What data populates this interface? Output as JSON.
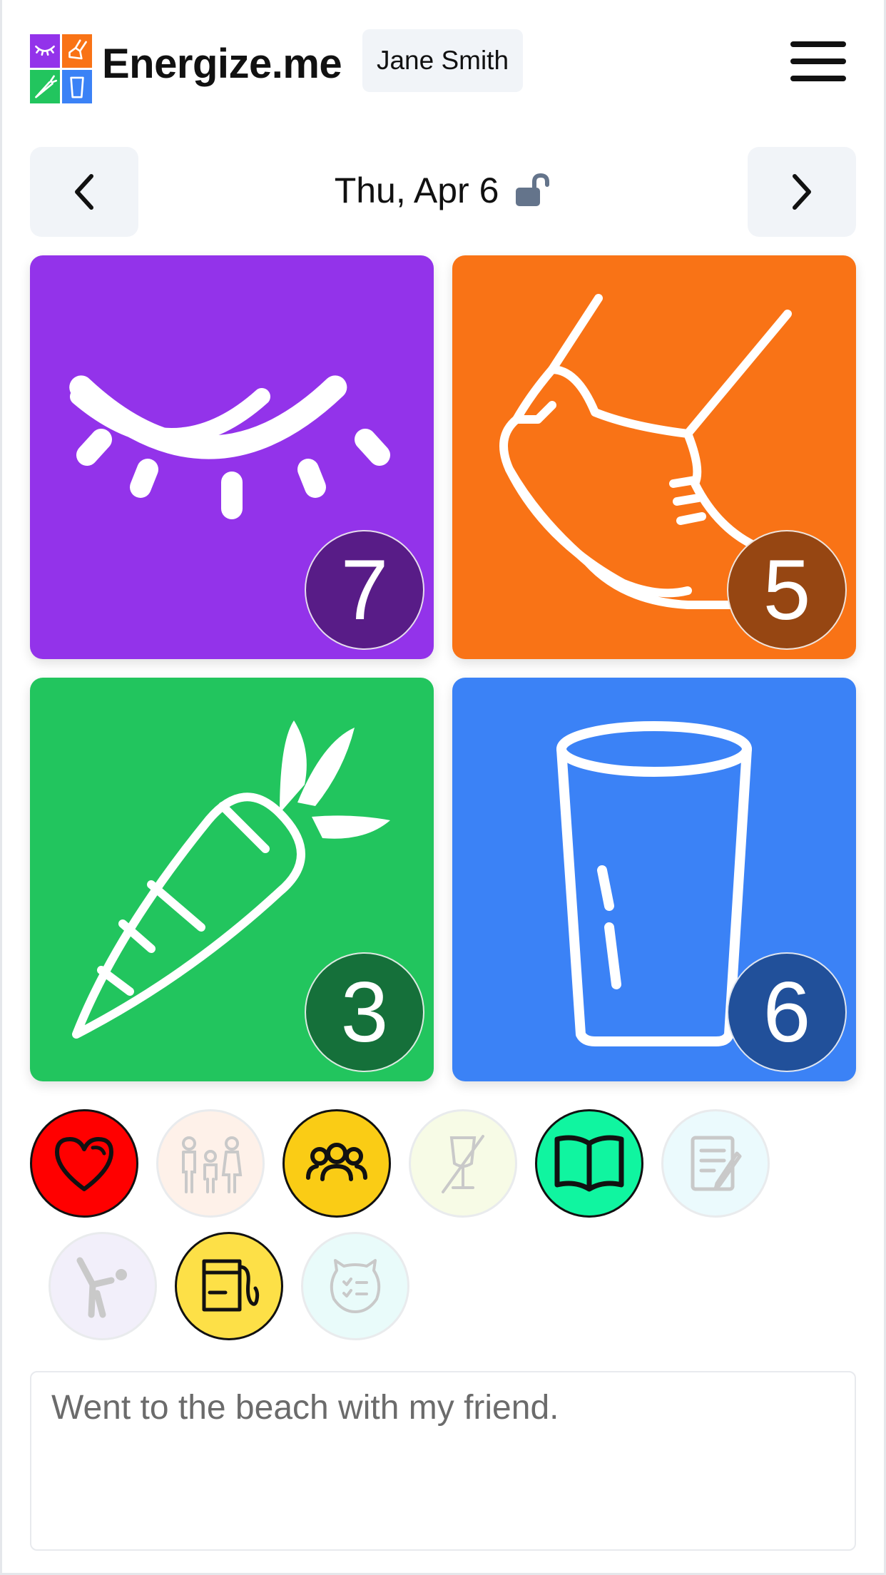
{
  "header": {
    "app_name": "Energize.me",
    "user_name": "Jane Smith",
    "logo_colors": [
      "#9333ea",
      "#f97316",
      "#22c55e",
      "#3b82f6"
    ]
  },
  "date_nav": {
    "date_label": "Thu, Apr 6",
    "lock_state": "unlocked"
  },
  "tiles": [
    {
      "name": "sleep",
      "icon": "closed-eye-icon",
      "color": "#9333ea",
      "badge_color": "#581c87",
      "score": "7"
    },
    {
      "name": "exercise",
      "icon": "sneaker-icon",
      "color": "#f97316",
      "badge_color": "#964612",
      "score": "5"
    },
    {
      "name": "food",
      "icon": "carrot-icon",
      "color": "#22c55e",
      "badge_color": "#15703a",
      "score": "3"
    },
    {
      "name": "water",
      "icon": "glass-icon",
      "color": "#3b82f6",
      "badge_color": "#21509a",
      "score": "6"
    }
  ],
  "activities": [
    {
      "name": "love",
      "icon": "heart-icon",
      "color": "#ff0000",
      "active": true
    },
    {
      "name": "family",
      "icon": "family-icon",
      "color": "#fde2cf",
      "active": false
    },
    {
      "name": "friends",
      "icon": "friends-icon",
      "color": "#facc15",
      "active": true
    },
    {
      "name": "no-alcohol",
      "icon": "no-drink-icon",
      "color": "#eef8c8",
      "active": false
    },
    {
      "name": "reading",
      "icon": "book-icon",
      "color": "#10f5a0",
      "active": true
    },
    {
      "name": "journaling",
      "icon": "journal-icon",
      "color": "#d3f4fb",
      "active": false
    },
    {
      "name": "stretching",
      "icon": "stretch-icon",
      "color": "#e4dcf5",
      "active": false
    },
    {
      "name": "flossing",
      "icon": "floss-icon",
      "color": "#fde047",
      "active": true
    },
    {
      "name": "mood-check",
      "icon": "mood-icon",
      "color": "#cff7f4",
      "active": false
    }
  ],
  "notes": {
    "value": "Went to the beach with my friend."
  }
}
